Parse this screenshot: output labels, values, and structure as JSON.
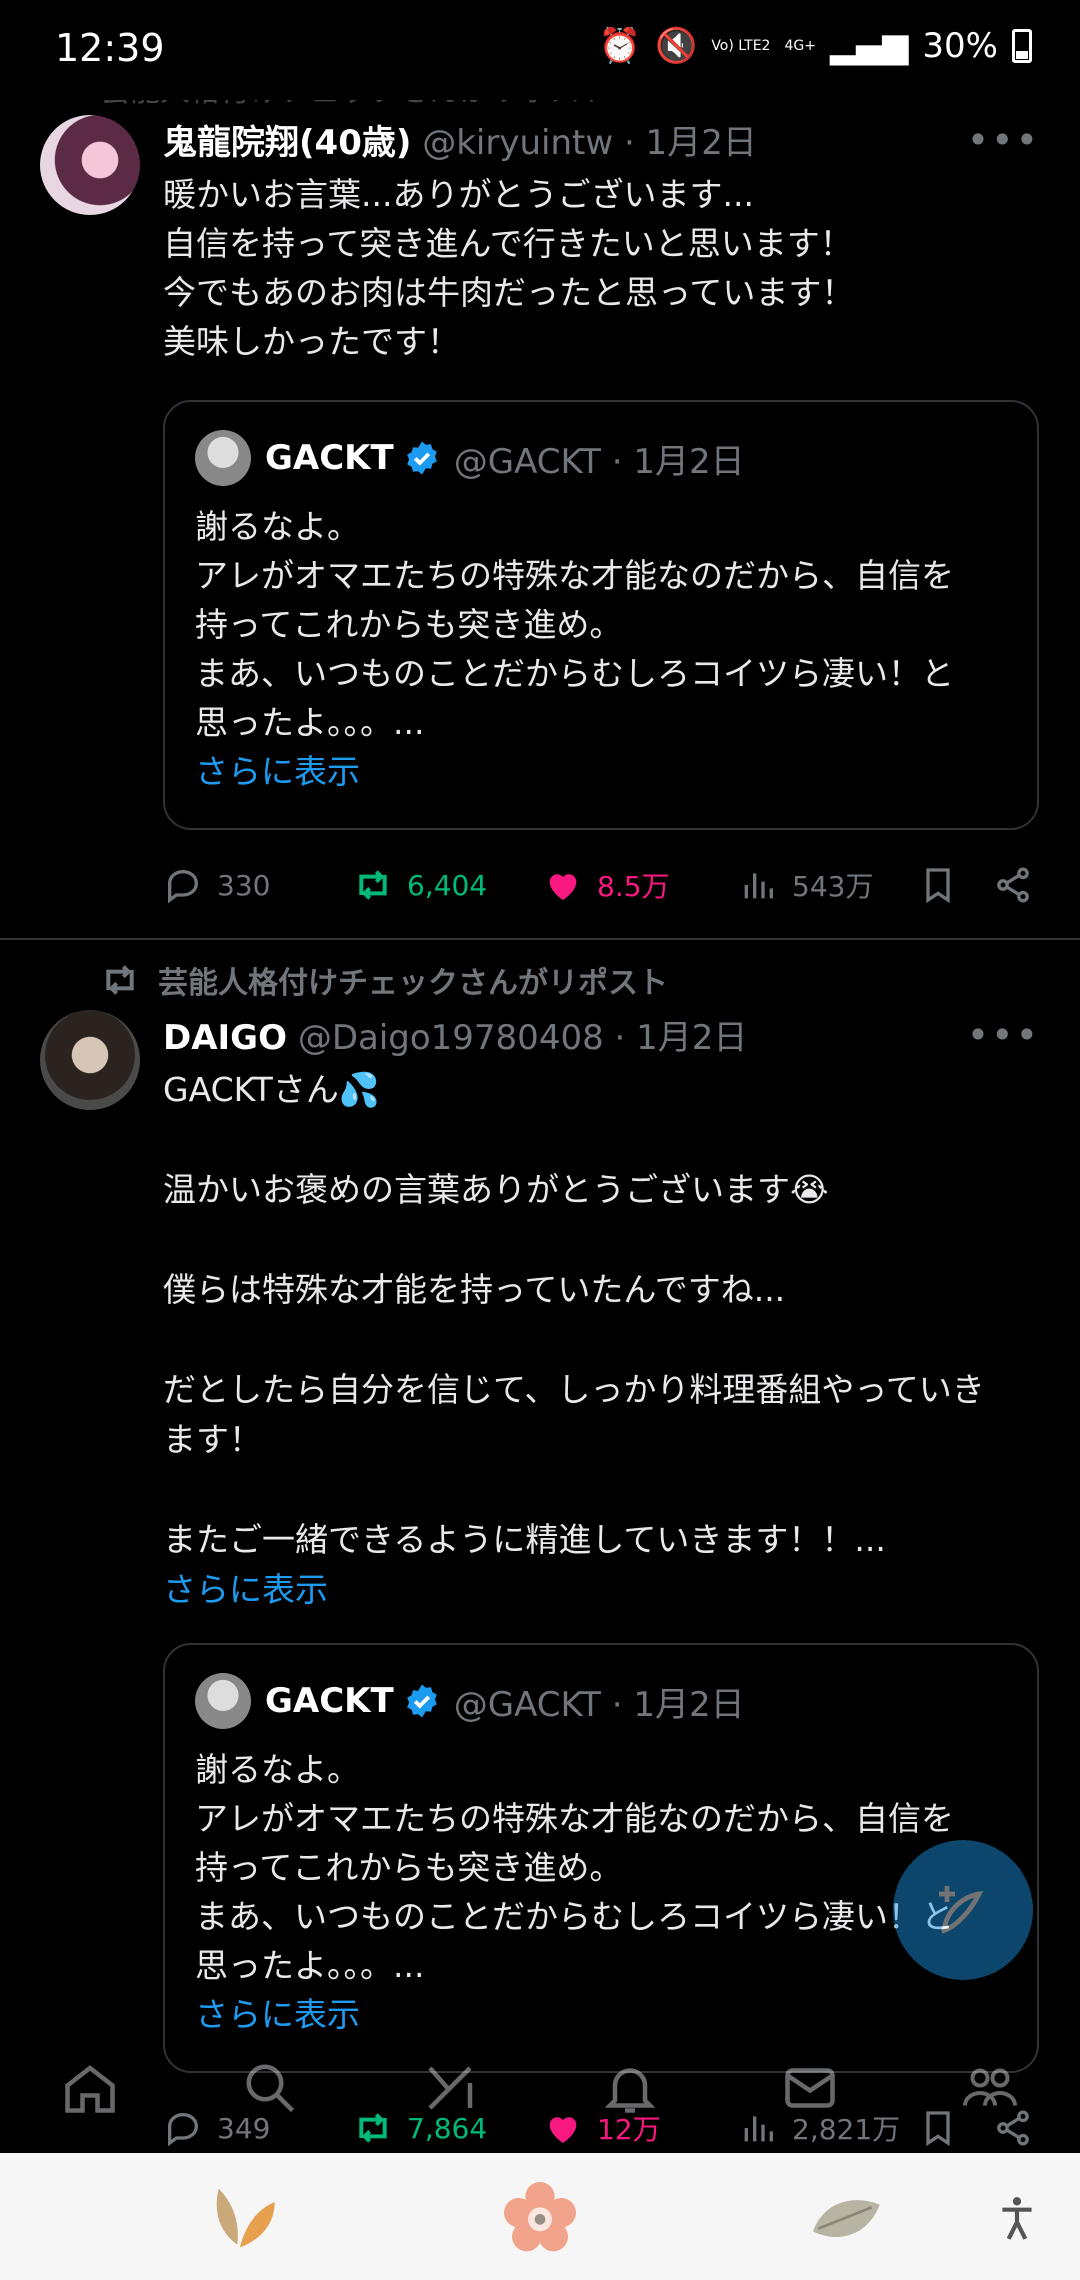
{
  "status": {
    "time": "12:39",
    "network": "Vo) LTE2",
    "network2": "4G+",
    "battery": "30%"
  },
  "header_cut": "芸能人格付けチェックさんがリポスト",
  "tweet1": {
    "name": "鬼龍院翔(40歳)",
    "handle": "@kiryuintw · 1月2日",
    "lines": [
      "暖かいお言葉...ありがとうございます...",
      "自信を持って突き進んで行きたいと思います！",
      "今でもあのお肉は牛肉だったと思っています！",
      "美味しかったです！"
    ],
    "quote": {
      "name": "GACKT",
      "handle": "@GACKT · 1月2日",
      "lines": [
        "謝るなよ。",
        "アレがオマエたちの特殊な才能なのだから、自信を",
        "持ってこれからも突き進め。",
        "まあ、いつものことだからむしろコイツら凄い！と",
        "思ったよ。。。..."
      ],
      "show_more": "さらに表示"
    },
    "stats": {
      "replies": "330",
      "reposts": "6,404",
      "likes": "8.5万",
      "views": "543万"
    }
  },
  "repost_label": "芸能人格付けチェックさんがリポスト",
  "tweet2": {
    "name": "DAIGO",
    "handle": "@Daigo19780408 · 1月2日",
    "lines": [
      "GACKTさん💦",
      "",
      "温かいお褒めの言葉ありがとうございます😭",
      "",
      "僕らは特殊な才能を持っていたんですね...",
      "",
      "だとしたら自分を信じて、しっかり料理番組やっていき",
      "ます！",
      "",
      "またご一緒できるように精進していきます！！..."
    ],
    "show_more": "さらに表示",
    "quote": {
      "name": "GACKT",
      "handle": "@GACKT · 1月2日",
      "lines": [
        "謝るなよ。",
        "アレがオマエたちの特殊な才能なのだから、自信を",
        "持ってこれからも突き進め。",
        "まあ、いつものことだからむしろコイツら凄い！と",
        "思ったよ。。。..."
      ],
      "show_more": "さらに表示"
    },
    "stats": {
      "replies": "349",
      "reposts": "7,864",
      "likes": "12万",
      "views": "2,821万"
    }
  },
  "colors": {
    "accent": "#1d9bf0",
    "repost": "#00ba7c",
    "like": "#f91880"
  }
}
